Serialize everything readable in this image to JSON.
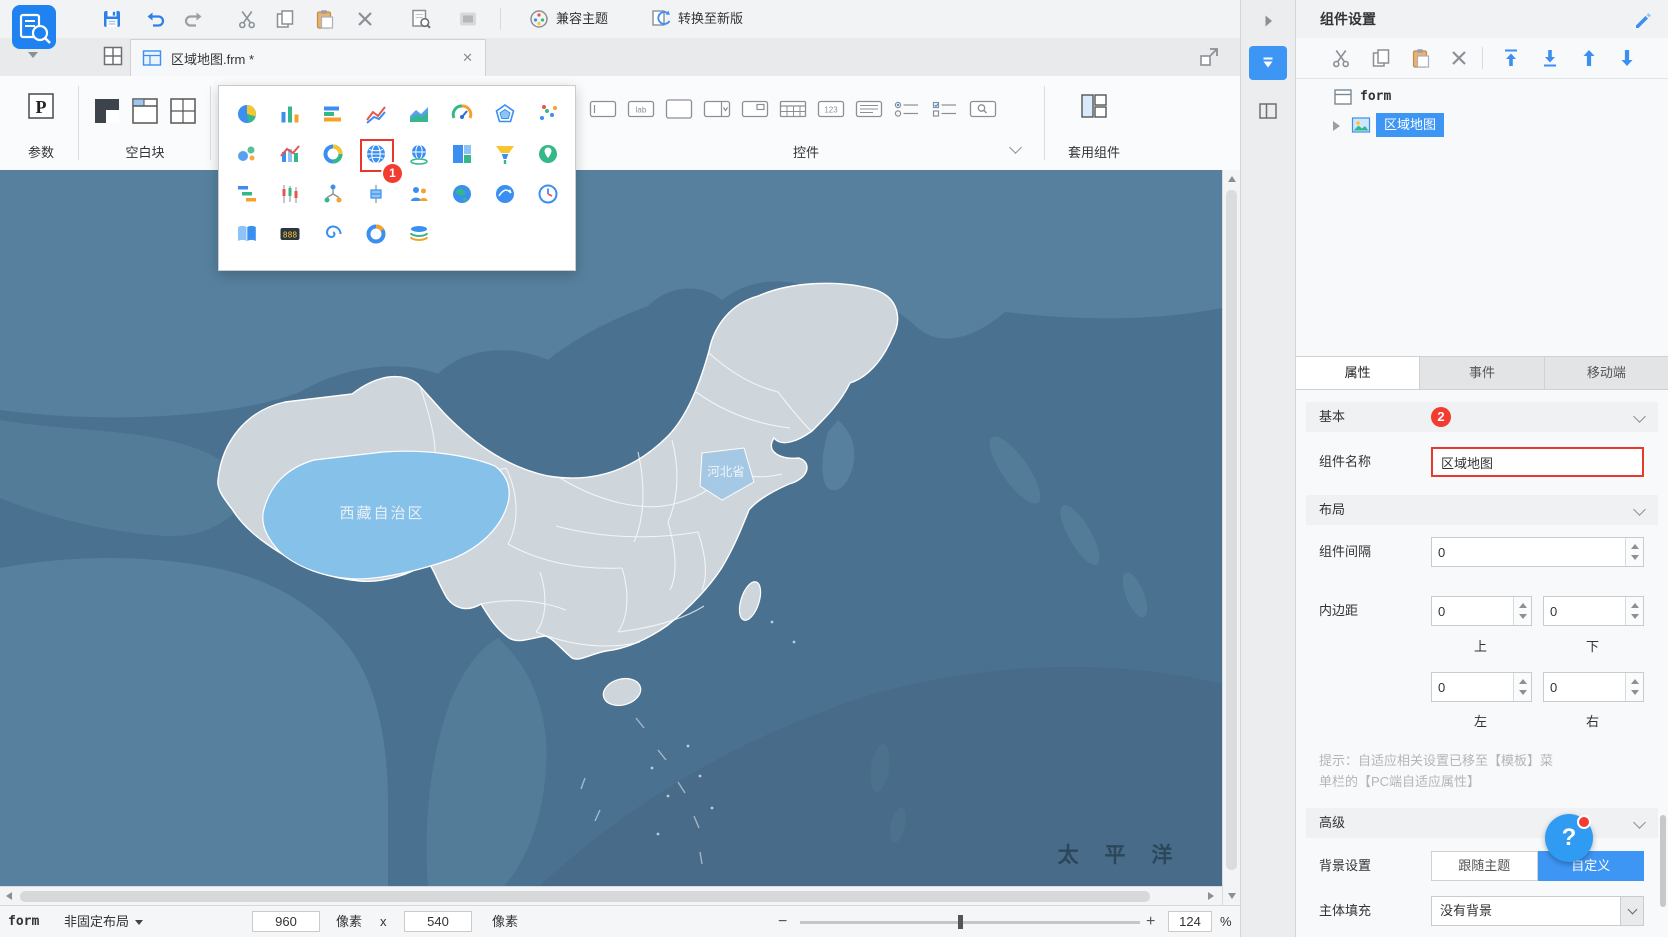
{
  "titlebar": {
    "compat_theme": "兼容主题",
    "convert_new": "转换至新版"
  },
  "tabs_bar": {
    "doc_tab": "区域地图.frm *",
    "close": "✕"
  },
  "ribbon": {
    "param": {
      "label": "参数"
    },
    "blank": {
      "label": "空白块",
      "icons": [
        "report",
        "tab",
        "absolute"
      ]
    },
    "widgets": {
      "label": "控件",
      "icons": [
        "text",
        "label",
        "textarea",
        "select",
        "frame",
        "calendar",
        "number",
        "lines",
        "radio",
        "check",
        "search"
      ]
    },
    "components": {
      "label": "套用组件"
    }
  },
  "chart_panel": {
    "badge": "1",
    "rows": [
      [
        {
          "type": "pie"
        },
        {
          "type": "column"
        },
        {
          "type": "bar"
        },
        {
          "type": "line"
        },
        {
          "type": "area"
        },
        {
          "type": "gauge"
        },
        {
          "type": "radar"
        },
        {
          "type": "scatter"
        }
      ],
      [
        {
          "type": "bubble"
        },
        {
          "type": "combo"
        },
        {
          "type": "donut"
        },
        {
          "type": "map",
          "highlighted": true
        },
        {
          "type": "drill-map"
        },
        {
          "type": "treemap"
        },
        {
          "type": "funnel"
        },
        {
          "type": "gis-map"
        }
      ],
      [
        {
          "type": "gantt"
        },
        {
          "type": "stock"
        },
        {
          "type": "structure"
        },
        {
          "type": "box"
        },
        {
          "type": "crowd"
        },
        {
          "type": "earth"
        },
        {
          "type": "flow-map"
        },
        {
          "type": "time"
        }
      ],
      [
        {
          "type": "word-cloud"
        },
        {
          "type": "led"
        },
        {
          "type": "spiral"
        },
        {
          "type": "ring"
        },
        {
          "type": "layer"
        }
      ]
    ]
  },
  "map": {
    "tibet_label": "西藏自治区",
    "province_label": "河北省",
    "ocean_label": "太 平 洋"
  },
  "component_panel": {
    "title": "组件设置",
    "tree": {
      "root": "form",
      "selected": "区域地图"
    },
    "tabs": [
      {
        "label": "属性"
      },
      {
        "label": "事件"
      },
      {
        "label": "移动端"
      }
    ],
    "badge": "2",
    "basic_section": "基本",
    "layout_section": "布局",
    "advanced_section": "高级",
    "name_label": "组件名称",
    "name_value": "区域地图",
    "gap_label": "组件间隔",
    "gap_value": "0",
    "padding_label": "内边距",
    "pad_top": "0",
    "pad_bottom": "0",
    "pad_left": "0",
    "pad_right": "0",
    "dir_top": "上",
    "dir_bottom": "下",
    "dir_left": "左",
    "dir_right": "右",
    "hint_line1": "提示：自适应相关设置已移至【模板】菜",
    "hint_line2": "单栏的【PC端自适应属性】",
    "bg_label": "背景设置",
    "bg_follow": "跟随主题",
    "bg_custom": "自定义",
    "fill_label": "主体填充",
    "fill_value": "没有背景",
    "help": "?"
  },
  "status_bar": {
    "form": "form",
    "layout_mode": "非固定布局",
    "width_value": "960",
    "unit_w": "像素",
    "times": "x",
    "height_value": "540",
    "unit_h": "像素",
    "zoom_value": "124",
    "percent": "%"
  }
}
